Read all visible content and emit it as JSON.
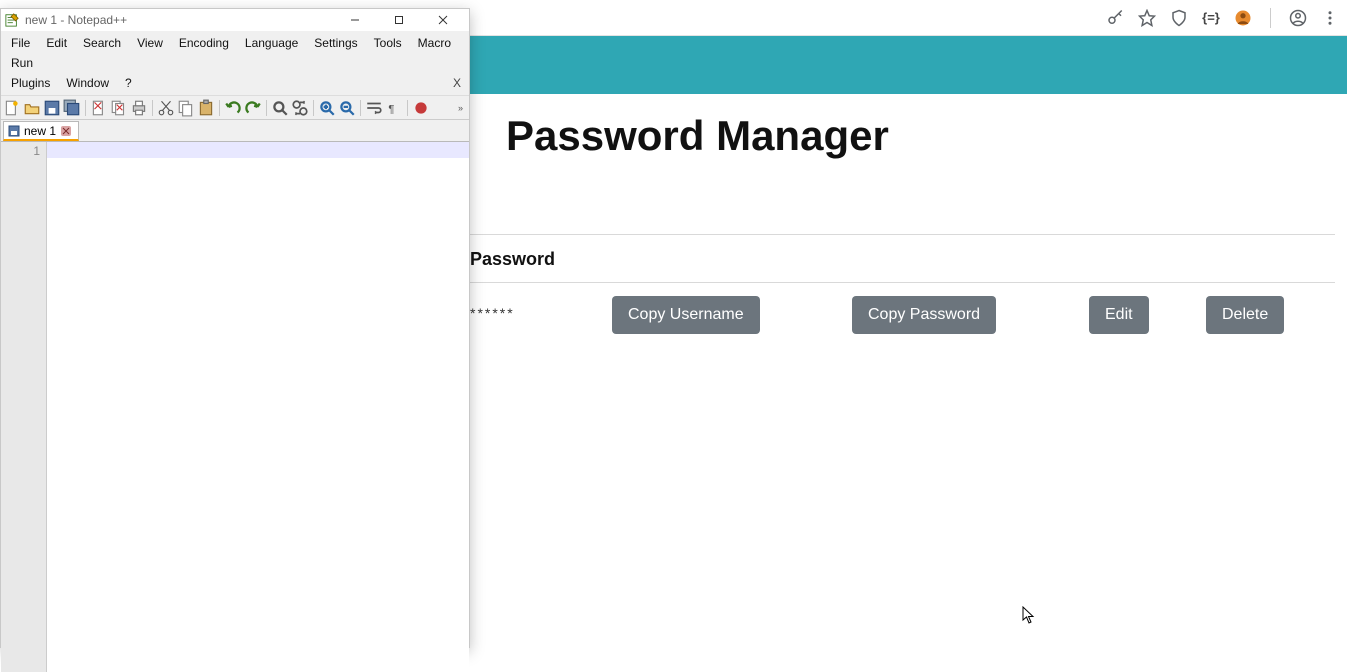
{
  "browser": {
    "band_color": "#2fa7b4",
    "icons": [
      "key",
      "star",
      "shield",
      "braces",
      "profile-badge",
      "account",
      "menu"
    ],
    "page": {
      "title": "Password Manager",
      "section_header": "Password",
      "row": {
        "password_masked": "******",
        "buttons": {
          "copy_user": "Copy Username",
          "copy_pass": "Copy Password",
          "edit": "Edit",
          "delete": "Delete"
        }
      }
    }
  },
  "notepadpp": {
    "title": "new 1 - Notepad++",
    "menus": [
      "File",
      "Edit",
      "Search",
      "View",
      "Encoding",
      "Language",
      "Settings",
      "Tools",
      "Macro",
      "Run",
      "Plugins",
      "Window",
      "?"
    ],
    "overflow_label": "X",
    "toolbar_more": "»",
    "tab": {
      "label": "new 1"
    },
    "gutter": {
      "line1": "1"
    }
  }
}
